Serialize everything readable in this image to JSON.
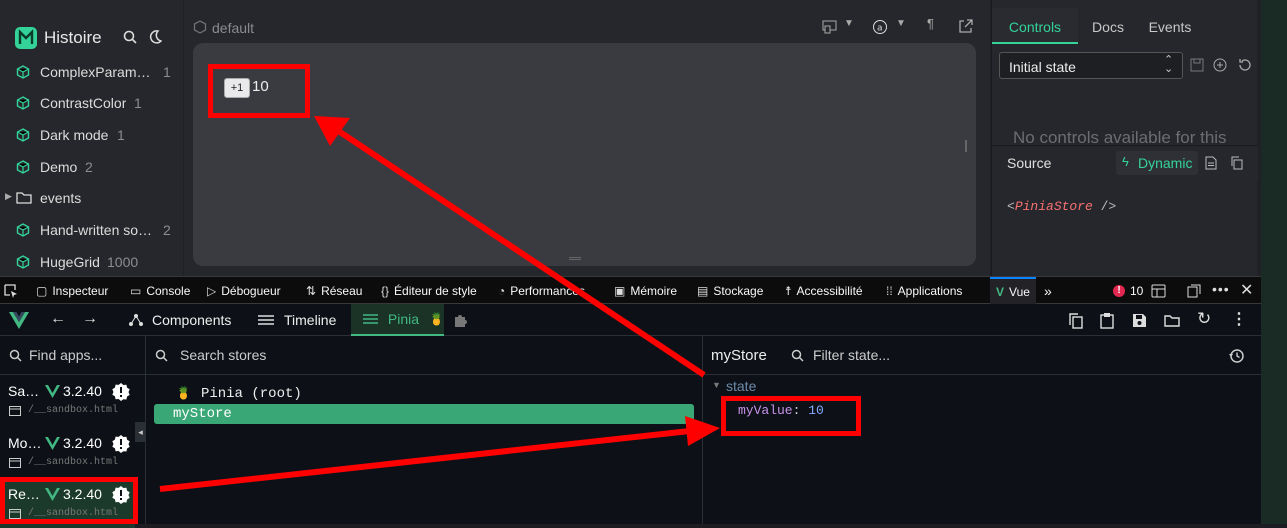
{
  "histoire": {
    "logo_text": "Histoire",
    "tree": [
      {
        "label": "ComplexParame…",
        "count": "1",
        "type": "story"
      },
      {
        "label": "ContrastColor",
        "count": "1",
        "type": "story"
      },
      {
        "label": "Dark mode",
        "count": "1",
        "type": "story"
      },
      {
        "label": "Demo",
        "count": "2",
        "type": "story"
      },
      {
        "label": "events",
        "count": "",
        "type": "folder"
      },
      {
        "label": "Hand-written so…",
        "count": "2",
        "type": "story"
      },
      {
        "label": "HugeGrid",
        "count": "1000",
        "type": "story"
      }
    ],
    "variant_title": "default",
    "preview": {
      "button_label": "+1",
      "value": "10"
    },
    "tabs": {
      "controls": "Controls",
      "docs": "Docs",
      "events": "Events"
    },
    "state_select": "Initial state",
    "no_controls": "No controls available for this",
    "source_label": "Source",
    "dynamic_label": "Dynamic",
    "source_code_tag": "PiniaStore"
  },
  "devtools": {
    "tabs": [
      "Inspecteur",
      "Console",
      "Débogueur",
      "Réseau",
      "Éditeur de style",
      "Performances",
      "Mémoire",
      "Stockage",
      "Accessibilité",
      "Applications",
      "Vue"
    ],
    "error_count": "10"
  },
  "vue": {
    "nav": {
      "components": "Components",
      "timeline": "Timeline",
      "pinia": "Pinia"
    },
    "find_apps_placeholder": "Find apps...",
    "apps": [
      {
        "name": "Sa…",
        "version": "3.2.40",
        "file": "/__sandbox.html"
      },
      {
        "name": "Mo…",
        "version": "3.2.40",
        "file": "/__sandbox.html"
      },
      {
        "name": "Re…",
        "version": "3.2.40",
        "file": "/__sandbox.html"
      }
    ],
    "search_stores_placeholder": "Search stores",
    "stores": {
      "root": "Pinia (root)",
      "selected": "myStore"
    },
    "state_panel": {
      "title": "myStore",
      "filter_placeholder": "Filter state...",
      "section": "state",
      "key": "myValue",
      "value": "10"
    }
  },
  "colors": {
    "accent": "#42b883",
    "annotation": "#ff0000"
  }
}
